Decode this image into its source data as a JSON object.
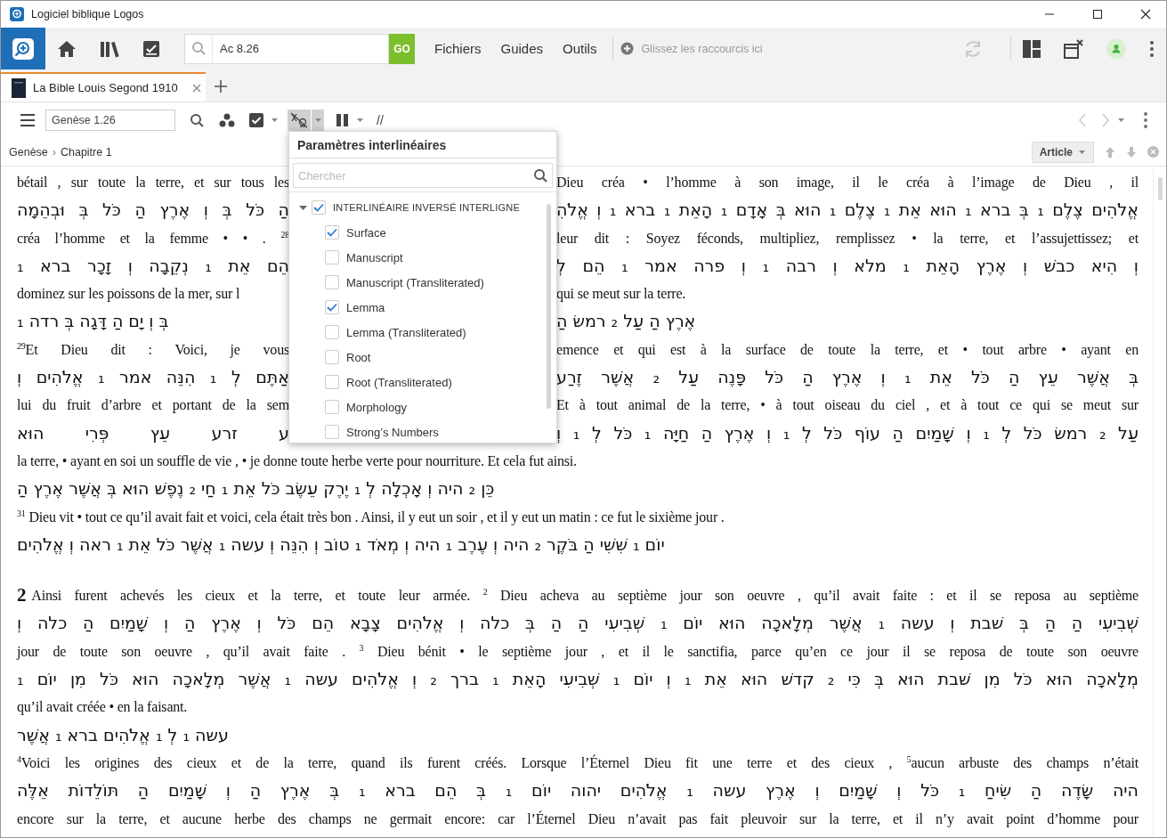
{
  "window": {
    "title": "Logiciel biblique Logos"
  },
  "toolbar": {
    "search": {
      "value": "Ac 8.26"
    },
    "go_button": "GO",
    "menus": [
      "Fichiers",
      "Guides",
      "Outils"
    ],
    "shortcuts_hint": "Glissez les raccourcis ici"
  },
  "tabs": [
    {
      "label": "La Bible Louis Segond 1910",
      "selected": true
    }
  ],
  "resource_toolbar": {
    "reference": {
      "value": "Genèse 1.26"
    },
    "interlinear_pressed": true,
    "parallel_label": "//"
  },
  "breadcrumb": {
    "items": [
      "Genèse",
      "Chapitre 1"
    ],
    "separator": "›"
  },
  "article_button": "Article",
  "interlinear_popup": {
    "title": "Paramètres interlinéaires",
    "search": {
      "placeholder": "Chercher"
    },
    "items": [
      {
        "label": "INTERLINÉAIRE INVERSÉ INTERLIGNE",
        "checked": true,
        "expanded": true,
        "children": [
          {
            "label": "Surface",
            "checked": true
          },
          {
            "label": "Manuscript",
            "checked": false
          },
          {
            "label": "Manuscript (Transliterated)",
            "checked": false
          },
          {
            "label": "Lemma",
            "checked": true
          },
          {
            "label": "Lemma (Transliterated)",
            "checked": false
          },
          {
            "label": "Root",
            "checked": false
          },
          {
            "label": "Root (Transliterated)",
            "checked": false
          },
          {
            "label": "Morphology",
            "checked": false
          },
          {
            "label": "Strong’s Numbers",
            "checked": false
          }
        ]
      }
    ]
  },
  "passages": [
    {
      "lines": [
        {
          "kind": "french",
          "left": "bétail , sur toute la terre, et sur tous les",
          "right": "Dieu créa • l’homme à son image, il le créa à l’image de Dieu , il",
          "last": false
        },
        {
          "kind": "hebrew",
          "left": "הַ כֹּל בְּ וְ אֶרֶץ הַ כֹּל בְּ וּבְהֵמָה",
          "right": "אֱלֹהִים צֶלֶם ₁ בְּ ברא ₁ הוּא אֵת ₁ צֶלֶם ₁ הוּא בְּ אָדָם ₁ הָאֵת ₁ ברא ₁ וְ אֱלֹהִ",
          "last": false
        },
        {
          "kind": "french",
          "left": "créa l’homme et la femme • • . $^{28}$",
          "right": "leur dit : Soyez féconds, multipliez, remplissez • la terre, et l’assujettissez; et",
          "last": false
        },
        {
          "kind": "hebrew",
          "left": "הֵם אֵת ₁ נְקֵבָה וְ זָכָר ברא ₁",
          "right": "וְ הִיא כבשׁ וְ אֶרֶץ הָאֵת ₁ מלא וְ רבה ₁ וְ פרה אמר ₁ הֵם לְ",
          "last": false
        },
        {
          "kind": "french",
          "left": "dominez sur les poissons de la mer, sur l",
          "right": "qui se meut sur la terre.",
          "last": true
        },
        {
          "kind": "hebrew",
          "left": "בְּ וְ יָם הַ דָּגָה בְּ רדה ₁",
          "right": "אֶרֶץ הַ עַל ₂ רמשׂ הַ",
          "last": true
        },
        {
          "kind": "french",
          "left": "$^{29}$Et Dieu dit : Voici, je vous",
          "right": "emence et qui est à la surface de toute la terre, et • tout arbre • ayant en",
          "last": false
        },
        {
          "kind": "hebrew",
          "left": "אַתֶּם לְ ₁ הִנֵּה אמר ₁ אֱלֹהִים וְ",
          "right": "בְּ אֲשֶׁר עֵץ הַ כֹּל אֵת ₁ וְ אֶרֶץ הַ כֹּל פָּנֶה עַל ₂ אֲשֶׁר זֶרַע",
          "last": false
        },
        {
          "kind": "french",
          "left": "lui du fruit d’arbre et portant de la sem",
          "right": "Et à tout animal de la terre, • à tout oiseau du ciel , et à tout ce qui se meut sur",
          "last": false
        },
        {
          "kind": "hebrew",
          "left": "ע זרע עֵץ פְּרִי הוּא",
          "right": "עַל ₂ רמשׂ כֹּל לְ ₁ וְ שָׁמַיִם הַ עוֹף כֹּל לְ ₁ וְ אֶרֶץ הַ חַיָּה ₁ כֹּל לְ ₁ וְ",
          "last": false
        },
        {
          "kind": "french",
          "text": "la terre, • ayant en soi un souffle de vie , • je donne toute herbe verte pour nourriture. Et cela fut ainsi.",
          "last": true
        },
        {
          "kind": "hebrew",
          "text": "כֵּן ₂ היה וְ אָכְלָה לְ ₁ יֶרֶק עֵשֶׂב כֹּל אֵת ₁ חַי ₂ נֶפֶשׁ הוּא בְּ אֲשֶׁר אֶרֶץ הַ",
          "last": true
        },
        {
          "kind": "french",
          "text": "$^{31}$ Dieu vit • tout ce qu’il avait fait et voici, cela était très bon . Ainsi, il y eut un soir , et il y eut un matin : ce fut le sixième jour .",
          "last": true
        },
        {
          "kind": "hebrew",
          "text": "יוֹם ₁ שִׁשִּׁי הַ בֹּקֶר ₂ היה וְ עֶרֶב ₁ היה וְ מְאֹד ₁ טוֹב וְ הִנֵּה וְ עשה ₁ אֲשֶׁר כֹּל אֵת ₁ ראה וְ אֱלֹהִים",
          "last": true
        }
      ]
    },
    {
      "lines": [
        {
          "kind": "french",
          "chapter": "2",
          "text": "Ainsi furent achevés les cieux et la terre, et toute leur armée. $^{2}$ Dieu acheva au septième jour son oeuvre , qu’il avait faite : et il se reposa au septième",
          "last": false
        },
        {
          "kind": "hebrew",
          "text": "שְׁבִיעִי הַ הַ בְּ שׁבת וְ עשה ₁ אֲשֶׁר מְלָאכָה הוּא יוֹם ₁ שְׁבִיעִי הַ הַ בְּ כלה וְ אֱלֹהִים צָבָא הֵם כֹּל וְ אֶרֶץ הַ וְ שָׁמַיִם הַ כלה וְ",
          "last": false
        },
        {
          "kind": "french",
          "text": "jour de toute son oeuvre , qu’il avait faite . $^{3}$ Dieu bénit • le septième jour , et il le sanctifia, parce qu’en ce jour il se reposa de toute son oeuvre",
          "last": false
        },
        {
          "kind": "hebrew",
          "text": "מְלָאכָה הוּא כֹּל מִן שׁבת הוּא בְּ כִּי ₂ קדשׁ הוּא אֵת ₁ וְ יוֹם ₁ שְׁבִיעִי הָאֵת ₁ ברך ₂ וְ אֱלֹהִים עשה ₁ אֲשֶׁר מְלָאכָה הוּא כֹּל מִן יוֹם ₁",
          "last": false
        },
        {
          "kind": "french",
          "text": "qu’il avait créée • en la faisant.",
          "last": true
        },
        {
          "kind": "hebrew",
          "text": "עשה ₁ לְ ₁ אֱלֹהִים ברא ₁ אֲשֶׁר",
          "last": true
        },
        {
          "kind": "french",
          "text": "$^{4}$Voici les origines des cieux et de la terre, quand ils furent créés. Lorsque l’Éternel Dieu fit une terre et des cieux , $^{5}$aucun arbuste des champs n’était",
          "last": false
        },
        {
          "kind": "hebrew",
          "text": "היה שָׂדֶה הַ שִׂיחַ ₁ כֹּל וְ שָׁמַיִם וְ אֶרֶץ עשה ₁ אֱלֹהִים יהוה יוֹם ₁ בְּ הֵם ברא ₁ בְּ אֶרֶץ הַ וְ שָׁמַיִם הַ תּוֹלֵדוֹת אֵלֶּה",
          "last": false
        },
        {
          "kind": "french",
          "text": "encore sur la terre, et aucune herbe des champs ne germait encore: car l’Éternel Dieu n’avait pas fait pleuvoir sur la terre, et il n’y avait point d’homme pour",
          "last": false
        }
      ]
    }
  ]
}
